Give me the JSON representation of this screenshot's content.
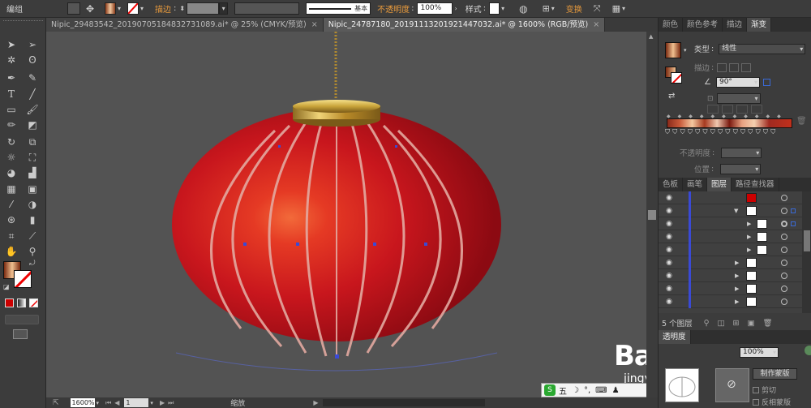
{
  "toolbar_top": {
    "mode_label": "编组",
    "stroke_label": "描边",
    "stroke_style": "基本",
    "opacity_label": "不透明度",
    "opacity_value": "100%",
    "style_label": "样式",
    "transform_label": "变换"
  },
  "tabs": [
    {
      "label": "Nipic_29483542_20190705184832731089.ai* @ 25% (CMYK/预览)",
      "active": false
    },
    {
      "label": "Nipic_24787180_20191113201921447032.ai* @ 1600% (RGB/预览)",
      "active": true
    }
  ],
  "tab_close": "×",
  "color_panel": {
    "tabs": [
      "颜色",
      "颜色参考",
      "描边",
      "渐变"
    ],
    "type_label": "类型",
    "type_value": "线性",
    "stroke_label": "描边",
    "angle_value": "90°",
    "opacity_label": "不透明度",
    "position_label": "位置"
  },
  "layers_panel": {
    "tabs": [
      "色板",
      "画笔",
      "图层",
      "路径查找器"
    ],
    "count_label": "5 个图层"
  },
  "lower_panel": {
    "tab": "透明度",
    "opacity_value": "100%",
    "mask_button": "制作蒙版",
    "clip_label": "剪切",
    "invert_label": "反相蒙版"
  },
  "status": {
    "zoom": "1600%",
    "page": "1",
    "mode": "缩放"
  },
  "ime": {
    "label": "五"
  },
  "watermark": {
    "brand": "Baidu经验",
    "url": "jingyan.baidu.com"
  },
  "colors": {
    "lantern_red": "#c8161d",
    "gold": "#c9a43a",
    "anchor_blue": "#3a4ad6"
  }
}
